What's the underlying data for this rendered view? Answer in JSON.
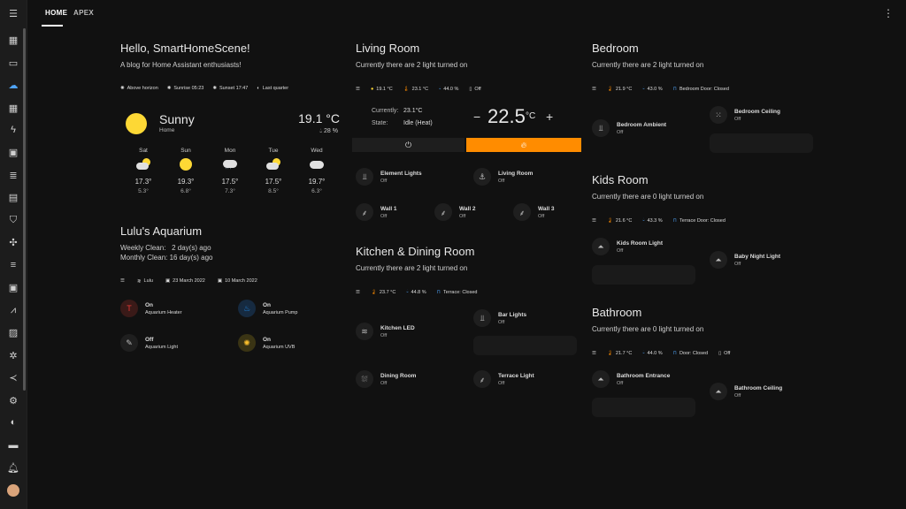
{
  "tabs": [
    "HOME",
    "APEX"
  ],
  "sidebar": {
    "icons": [
      "menu-icon",
      "dashboard-icon",
      "monitor-icon",
      "weather-icon",
      "dashboard-2-icon",
      "energy-icon",
      "badge-icon",
      "list-icon",
      "logbook-icon",
      "shield-icon",
      "network-icon",
      "server-icon",
      "chart-icon",
      "history-icon",
      "media-icon",
      "settings-icon",
      "vscode-icon",
      "gear-icon",
      "compass-icon",
      "slider-icon",
      "bell-icon",
      "avatar"
    ]
  },
  "welcome": {
    "title": "Hello, SmartHomeScene!",
    "subtitle": "A blog for Home Assistant enthusiasts!",
    "chips": [
      "Above horizon",
      "Sunrise 05:23",
      "Sunset 17:47",
      "Last quarter"
    ]
  },
  "weather": {
    "condition": "Sunny",
    "location": "Home",
    "temp": "19.1 °C",
    "humidity": "28 %",
    "forecast": [
      {
        "day": "Sat",
        "high": "17.3°",
        "low": "5.3°",
        "icon": "partly-cloudy-icon"
      },
      {
        "day": "Sun",
        "high": "19.3°",
        "low": "6.8°",
        "icon": "sun-icon"
      },
      {
        "day": "Mon",
        "high": "17.5°",
        "low": "7.3°",
        "icon": "rain-icon"
      },
      {
        "day": "Tue",
        "high": "17.5°",
        "low": "8.5°",
        "icon": "partly-cloudy-icon"
      },
      {
        "day": "Wed",
        "high": "19.7°",
        "low": "6.3°",
        "icon": "cloudy-icon"
      }
    ]
  },
  "aquarium": {
    "title": "Lulu's Aquarium",
    "weekly": "Weekly Clean:   2 day(s) ago",
    "monthly": "Monthly Clean: 16 day(s) ago",
    "chips": [
      "Lulu",
      "23 March 2022",
      "10 March 2022"
    ],
    "tiles": [
      {
        "state": "On",
        "name": "Aquarium Heater",
        "color": "#e53935"
      },
      {
        "state": "On",
        "name": "Aquarium Pump",
        "color": "#1e88e5"
      },
      {
        "state": "Off",
        "name": "Aquarium Light",
        "color": "#888888"
      },
      {
        "state": "On",
        "name": "Aquarium UVB",
        "color": "#fbc02d"
      }
    ]
  },
  "living": {
    "title": "Living Room",
    "subtitle": "Currently there are 2 light turned on",
    "chips": [
      "19.1 °C",
      "23.1 °C",
      "44.0 %",
      "Off"
    ],
    "currently_label": "Currently:",
    "currently_value": "23.1°C",
    "state_label": "State:",
    "state_value": "Idle (Heat)",
    "setpoint": "22.5",
    "unit": "°C",
    "minus": "−",
    "plus": "+",
    "tiles": [
      {
        "name": "Element Lights",
        "state": "Off"
      },
      {
        "name": "Living Room",
        "state": "Off"
      },
      {
        "name": "Wall 1",
        "state": "Off"
      },
      {
        "name": "Wall 2",
        "state": "Off"
      },
      {
        "name": "Wall 3",
        "state": "Off"
      }
    ]
  },
  "kitchen": {
    "title": "Kitchen & Dining Room",
    "subtitle": "Currently there are 2 light turned on",
    "chips": [
      "23.7 °C",
      "44.8 %",
      "Terrace: Closed"
    ],
    "tiles": [
      {
        "name": "Bar Lights",
        "state": "Off"
      },
      {
        "name": "Kitchen LED",
        "state": "Off"
      },
      {
        "name": "Dining Room",
        "state": "Off"
      },
      {
        "name": "Terrace Light",
        "state": "Off"
      }
    ]
  },
  "bedroom": {
    "title": "Bedroom",
    "subtitle": "Currently there are 2 light turned on",
    "chips": [
      "21.9 °C",
      "43.0 %",
      "Bedroom Door: Closed"
    ],
    "tiles": [
      {
        "name": "Bedroom Ceiling",
        "state": "Off"
      },
      {
        "name": "Bedroom Ambient",
        "state": "Off"
      }
    ]
  },
  "kids": {
    "title": "Kids Room",
    "subtitle": "Currently there are 0 light turned on",
    "chips": [
      "21.6 °C",
      "43.3 %",
      "Terrace Door: Closed"
    ],
    "tiles": [
      {
        "name": "Kids Room Light",
        "state": "Off"
      },
      {
        "name": "Baby Night Light",
        "state": "Off"
      }
    ]
  },
  "bathroom": {
    "title": "Bathroom",
    "subtitle": "Currently there are 0 light turned on",
    "chips": [
      "21.7 °C",
      "44.0 %",
      "Door: Closed",
      "Off"
    ],
    "tiles": [
      {
        "name": "Bathroom Entrance",
        "state": "Off"
      },
      {
        "name": "Bathroom Ceiling",
        "state": "Off"
      }
    ]
  },
  "colors": {
    "accent": "#ff8c00",
    "sun": "#fdd835",
    "blue": "#4fa3f7"
  }
}
